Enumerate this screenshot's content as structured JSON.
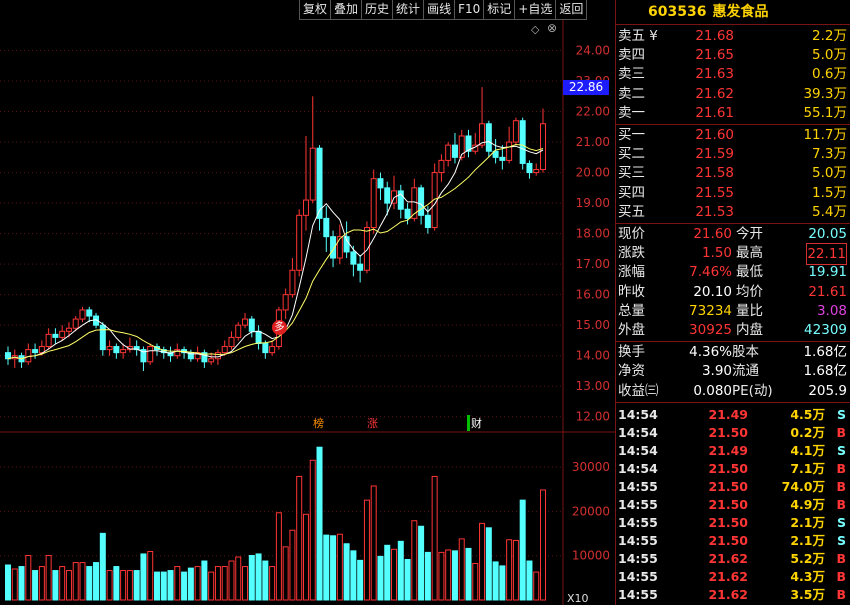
{
  "toolbar": {
    "items": [
      "复权",
      "叠加",
      "历史",
      "统计",
      "画线",
      "F10",
      "标记",
      "+自选",
      "返回"
    ]
  },
  "stock": {
    "code": "603536",
    "name": "惠发食品"
  },
  "orderbook": {
    "sells": [
      {
        "label": "卖五",
        "extra": "¥",
        "price": "21.68",
        "volume": "2.2万"
      },
      {
        "label": "卖四",
        "extra": "",
        "price": "21.65",
        "volume": "5.0万"
      },
      {
        "label": "卖三",
        "extra": "",
        "price": "21.63",
        "volume": "0.6万"
      },
      {
        "label": "卖二",
        "extra": "",
        "price": "21.62",
        "volume": "39.3万"
      },
      {
        "label": "卖一",
        "extra": "",
        "price": "21.61",
        "volume": "55.1万"
      }
    ],
    "buys": [
      {
        "label": "买一",
        "price": "21.60",
        "volume": "11.7万"
      },
      {
        "label": "买二",
        "price": "21.59",
        "volume": "7.3万"
      },
      {
        "label": "买三",
        "price": "21.58",
        "volume": "5.0万"
      },
      {
        "label": "买四",
        "price": "21.55",
        "volume": "1.5万"
      },
      {
        "label": "买五",
        "price": "21.53",
        "volume": "5.4万"
      }
    ]
  },
  "quote": [
    {
      "l1": "现价",
      "v1": "21.60",
      "c1": "red",
      "l2": "今开",
      "v2": "20.05",
      "c2": "cyan"
    },
    {
      "l1": "涨跌",
      "v1": "1.50",
      "c1": "red",
      "l2": "最高",
      "v2": "22.11",
      "c2": "red"
    },
    {
      "l1": "涨幅",
      "v1": "7.46%",
      "c1": "red",
      "l2": "最低",
      "v2": "19.91",
      "c2": "cyan"
    },
    {
      "l1": "昨收",
      "v1": "20.10",
      "c1": "white",
      "l2": "均价",
      "v2": "21.61",
      "c2": "red"
    },
    {
      "l1": "总量",
      "v1": "73234",
      "c1": "yellow",
      "l2": "量比",
      "v2": "3.08",
      "c2": "magenta"
    },
    {
      "l1": "外盘",
      "v1": "30925",
      "c1": "red",
      "l2": "内盘",
      "v2": "42309",
      "c2": "cyan"
    }
  ],
  "quote2": [
    {
      "l1": "换手",
      "v1": "4.36%",
      "l2": "股本",
      "v2": "1.68亿"
    },
    {
      "l1": "净资",
      "v1": "3.90",
      "l2": "流通",
      "v2": "1.68亿"
    },
    {
      "l1": "收益㈢",
      "v1": "0.080",
      "l2": "PE(动)",
      "v2": "205.9"
    }
  ],
  "ticks": [
    {
      "t": "14:54",
      "p": "21.49",
      "v": "4.5万",
      "s": "S"
    },
    {
      "t": "14:54",
      "p": "21.50",
      "v": "0.2万",
      "s": "B"
    },
    {
      "t": "14:54",
      "p": "21.49",
      "v": "4.1万",
      "s": "S"
    },
    {
      "t": "14:54",
      "p": "21.50",
      "v": "7.1万",
      "s": "B"
    },
    {
      "t": "14:55",
      "p": "21.50",
      "v": "74.0万",
      "s": "B"
    },
    {
      "t": "14:55",
      "p": "21.50",
      "v": "4.9万",
      "s": "B"
    },
    {
      "t": "14:55",
      "p": "21.50",
      "v": "2.1万",
      "s": "S"
    },
    {
      "t": "14:55",
      "p": "21.50",
      "v": "2.1万",
      "s": "S"
    },
    {
      "t": "14:55",
      "p": "21.62",
      "v": "5.2万",
      "s": "B"
    },
    {
      "t": "14:55",
      "p": "21.62",
      "v": "4.3万",
      "s": "B"
    },
    {
      "t": "14:55",
      "p": "21.62",
      "v": "3.5万",
      "s": "B"
    }
  ],
  "chart": {
    "current_price": "22.86",
    "price_ticks": [
      "24.00",
      "23.00",
      "22.00",
      "21.00",
      "20.00",
      "19.00",
      "18.00",
      "17.00",
      "16.00",
      "15.00",
      "14.00",
      "13.00",
      "12.00"
    ],
    "vol_ticks": [
      "30000",
      "20000",
      "10000"
    ],
    "vol_unit": "X10",
    "markers": [
      "榜",
      "涨",
      "财"
    ],
    "signal": "多",
    "colors": {
      "up": "#ff3535",
      "down": "#54ffff",
      "ma5": "#ffffff",
      "ma10": "#ffff66"
    }
  },
  "chart_data": {
    "type": "candlestick",
    "series": "daily K-line",
    "candles": [
      [
        14.1,
        13.9,
        14.3,
        13.7
      ],
      [
        13.9,
        14.0,
        14.2,
        13.6
      ],
      [
        14.0,
        13.8,
        14.1,
        13.6
      ],
      [
        13.8,
        14.2,
        14.4,
        13.7
      ],
      [
        14.2,
        14.1,
        14.4,
        13.9
      ],
      [
        14.1,
        14.3,
        14.5,
        14.0
      ],
      [
        14.3,
        14.7,
        14.9,
        14.2
      ],
      [
        14.7,
        14.6,
        14.9,
        14.4
      ],
      [
        14.6,
        14.8,
        15.0,
        14.5
      ],
      [
        14.8,
        14.9,
        15.1,
        14.6
      ],
      [
        14.9,
        15.2,
        15.3,
        14.8
      ],
      [
        15.2,
        15.5,
        15.6,
        15.1
      ],
      [
        15.5,
        15.3,
        15.6,
        15.1
      ],
      [
        15.3,
        15.0,
        15.4,
        14.9
      ],
      [
        15.0,
        14.2,
        15.1,
        14.0
      ],
      [
        14.2,
        14.3,
        14.5,
        14.0
      ],
      [
        14.3,
        14.1,
        14.4,
        13.9
      ],
      [
        14.1,
        14.2,
        14.4,
        13.9
      ],
      [
        14.2,
        14.3,
        14.6,
        14.1
      ],
      [
        14.3,
        14.2,
        14.5,
        14.0
      ],
      [
        14.2,
        13.8,
        14.3,
        13.5
      ],
      [
        13.8,
        14.3,
        14.4,
        13.7
      ],
      [
        14.3,
        14.2,
        14.4,
        14.0
      ],
      [
        14.2,
        14.1,
        14.3,
        13.9
      ],
      [
        14.1,
        14.0,
        14.3,
        13.8
      ],
      [
        14.0,
        14.2,
        14.4,
        13.9
      ],
      [
        14.2,
        14.1,
        14.3,
        13.9
      ],
      [
        14.1,
        13.9,
        14.2,
        13.8
      ],
      [
        13.9,
        14.1,
        14.3,
        13.8
      ],
      [
        14.1,
        13.8,
        14.2,
        13.6
      ],
      [
        13.8,
        13.9,
        14.1,
        13.7
      ],
      [
        13.9,
        14.1,
        14.2,
        13.7
      ],
      [
        14.1,
        14.3,
        14.5,
        14.0
      ],
      [
        14.3,
        14.6,
        14.8,
        14.2
      ],
      [
        14.6,
        15.0,
        15.1,
        14.5
      ],
      [
        15.0,
        15.2,
        15.4,
        14.9
      ],
      [
        15.2,
        14.8,
        15.3,
        14.6
      ],
      [
        14.8,
        14.4,
        15.0,
        14.2
      ],
      [
        14.4,
        14.1,
        14.5,
        13.9
      ],
      [
        14.1,
        14.3,
        14.5,
        14.0
      ],
      [
        14.3,
        15.5,
        15.6,
        14.2
      ],
      [
        15.5,
        16.0,
        16.2,
        15.2
      ],
      [
        16.0,
        16.8,
        17.2,
        15.9
      ],
      [
        16.8,
        18.6,
        18.8,
        16.6
      ],
      [
        18.6,
        19.1,
        21.2,
        18.1
      ],
      [
        19.1,
        20.8,
        22.5,
        19.0
      ],
      [
        20.8,
        18.5,
        20.9,
        18.1
      ],
      [
        18.5,
        17.9,
        18.9,
        17.4
      ],
      [
        17.9,
        17.2,
        18.1,
        16.9
      ],
      [
        17.2,
        17.9,
        18.3,
        17.0
      ],
      [
        17.9,
        17.4,
        18.4,
        17.2
      ],
      [
        17.4,
        17.0,
        17.6,
        16.6
      ],
      [
        17.0,
        16.8,
        17.3,
        16.4
      ],
      [
        16.8,
        18.2,
        18.4,
        16.7
      ],
      [
        18.2,
        19.8,
        20.1,
        18.0
      ],
      [
        19.8,
        19.5,
        20.0,
        19.1
      ],
      [
        19.5,
        19.0,
        19.7,
        18.6
      ],
      [
        19.0,
        19.4,
        19.9,
        18.8
      ],
      [
        19.4,
        18.8,
        19.6,
        18.5
      ],
      [
        18.8,
        18.5,
        19.0,
        18.3
      ],
      [
        18.5,
        19.5,
        19.8,
        18.4
      ],
      [
        19.5,
        18.6,
        19.6,
        18.3
      ],
      [
        18.6,
        18.2,
        18.9,
        18.0
      ],
      [
        18.2,
        20.0,
        20.3,
        18.1
      ],
      [
        20.0,
        20.4,
        20.6,
        19.7
      ],
      [
        20.4,
        20.9,
        21.0,
        20.2
      ],
      [
        20.9,
        20.5,
        21.3,
        20.3
      ],
      [
        20.5,
        21.2,
        21.4,
        20.4
      ],
      [
        21.2,
        20.7,
        21.4,
        20.5
      ],
      [
        20.7,
        20.9,
        21.3,
        20.6
      ],
      [
        20.9,
        21.6,
        22.8,
        20.8
      ],
      [
        21.6,
        20.7,
        21.7,
        20.5
      ],
      [
        20.7,
        20.5,
        21.1,
        20.3
      ],
      [
        20.5,
        20.4,
        20.9,
        20.1
      ],
      [
        20.4,
        21.0,
        21.5,
        20.3
      ],
      [
        21.0,
        21.7,
        21.8,
        20.9
      ],
      [
        21.7,
        20.3,
        21.8,
        20.1
      ],
      [
        20.3,
        20.0,
        20.4,
        19.8
      ],
      [
        20.0,
        20.1,
        20.3,
        19.9
      ],
      [
        20.1,
        21.6,
        22.1,
        20.0
      ]
    ],
    "ylim": [
      11.5,
      25.0
    ],
    "volume_ylim": [
      0,
      35000
    ]
  }
}
